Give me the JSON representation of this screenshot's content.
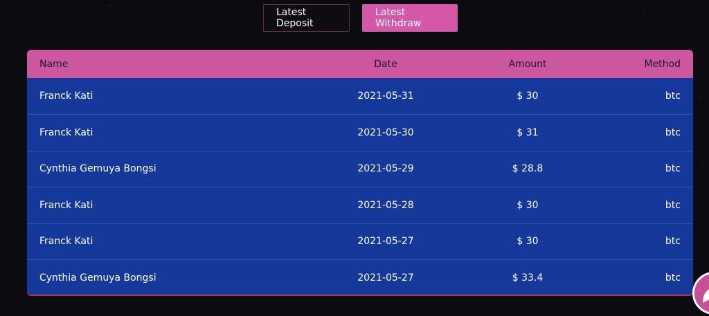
{
  "tabs": {
    "deposit_label": "Latest Deposit",
    "withdraw_label": "Latest Withdraw",
    "active": "withdraw"
  },
  "table": {
    "headers": {
      "name": "Name",
      "date": "Date",
      "amount": "Amount",
      "method": "Method"
    },
    "rows": [
      {
        "name": "Franck Kati",
        "date": "2021-05-31",
        "amount": "$ 30",
        "method": "btc"
      },
      {
        "name": "Franck Kati",
        "date": "2021-05-30",
        "amount": "$ 31",
        "method": "btc"
      },
      {
        "name": "Cynthia Gemuya Bongsi",
        "date": "2021-05-29",
        "amount": "$ 28.8",
        "method": "btc"
      },
      {
        "name": "Franck Kati",
        "date": "2021-05-28",
        "amount": "$ 30",
        "method": "btc"
      },
      {
        "name": "Franck Kati",
        "date": "2021-05-27",
        "amount": "$ 30",
        "method": "btc"
      },
      {
        "name": "Cynthia Gemuya Bongsi",
        "date": "2021-05-27",
        "amount": "$ 33.4",
        "method": "btc"
      }
    ]
  },
  "colors": {
    "header_bg": "#cc579f",
    "row_bg": "#14399a",
    "active_tab": "#d457a8"
  },
  "chat_widget": {
    "icon": "chat-icon"
  }
}
